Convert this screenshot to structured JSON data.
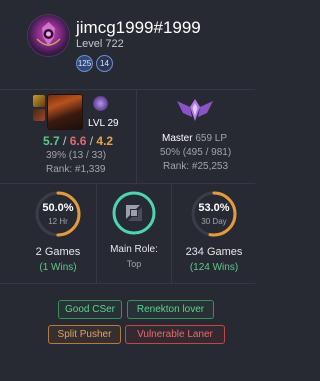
{
  "profile": {
    "username": "jimcg1999#1999",
    "level": "Level 722",
    "badges": [
      "125",
      "14"
    ]
  },
  "champion": {
    "level": "LVL 29",
    "kda": {
      "kills": "5.7",
      "deaths": "6.6",
      "assists": "4.2",
      "separator": " / "
    },
    "winrate": "39% (13 / 33)",
    "rank": "Rank: #1,339"
  },
  "ranked": {
    "tier": "Master",
    "lp": "659 LP",
    "winrate": "50% (495 / 981)",
    "rank": "Rank: #25,253"
  },
  "recent": {
    "left": {
      "percent": "50.0%",
      "period": "12 Hr",
      "games": "2 Games",
      "wins": "(1 Wins)",
      "value": 0.5
    },
    "middle": {
      "label": "Main Role:",
      "value": "Top"
    },
    "right": {
      "percent": "53.0%",
      "period": "30 Day",
      "games": "234 Games",
      "wins": "(124 Wins)",
      "value": 0.53
    }
  },
  "tags": [
    {
      "label": "Good CSer",
      "color": "green"
    },
    {
      "label": "Renekton lover",
      "color": "green"
    },
    {
      "label": "Split Pusher",
      "color": "orange"
    },
    {
      "label": "Vulnerable Laner",
      "color": "red"
    }
  ],
  "colors": {
    "background": "#282a33",
    "kills": "#5bc98a",
    "deaths": "#e06a6a",
    "assists": "#e5a24a",
    "ring": "#e59a3c",
    "role_ring": "#4fd4b0"
  },
  "icons": {
    "avatar": "crest-avatar-icon",
    "emblem": "master-emblem-icon",
    "role": "top-lane-icon"
  }
}
